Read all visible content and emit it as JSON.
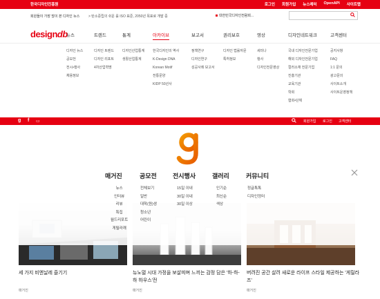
{
  "top_bar": {
    "org": "한국디자인진흥원",
    "links": [
      "로그인",
      "회원가입",
      "뉴스레터",
      "OpenAPI",
      "사이트맵"
    ]
  },
  "notice": {
    "headline": "회원들이 가장 많이 본 디자인 뉴스",
    "item": "> 탄소중립의 쉬운 룰 ISO 표준, 2050년 목표로 개발 중",
    "right": "대한민국디자인전람회..."
  },
  "nav": {
    "logo_main": "design",
    "logo_suffix": "db",
    "items": [
      "뉴스",
      "트렌드",
      "통계",
      "아카이브",
      "보고서",
      "권리보호",
      "영상",
      "디자인네트워크",
      "고객센터"
    ],
    "active_index": 3
  },
  "dropdown": {
    "col_news": [
      "디자인 뉴스",
      "공모전",
      "전시•행사",
      "채용정보"
    ],
    "col_trend": [
      "디자인 트렌드",
      "디자인 리포트",
      "4차산업혁명"
    ],
    "col_stats": [
      "디자인산업통계",
      "생활산업통계"
    ],
    "col_archive": [
      "한국디자인의 역사",
      "K-Design DNA",
      "Korean Motif",
      "전통문양",
      "KIDP 50년사"
    ],
    "col_report": [
      "정책연구",
      "디자인연구",
      "성공사례 보고서"
    ],
    "col_rights": [
      "디자인 법률자문",
      "특허정보"
    ],
    "col_video": [
      "세미나",
      "행사",
      "디자인전문영상"
    ],
    "col_network": [
      "국내 디자인전문기업",
      "해외 디자인전문기업",
      "컬러소재 전문기업",
      "진흥기관",
      "교육기관",
      "학회",
      "협회•단체"
    ],
    "col_support": [
      "공지사항",
      "FAQ",
      "1:1 문의",
      "광고문의",
      "사이트소개",
      "사이트운영정책"
    ]
  },
  "red_bar": {
    "icons": [
      "g",
      "f",
      "▭"
    ],
    "links": [
      "회원가입",
      "로그인",
      "고객센터"
    ]
  },
  "brand_mark": "g",
  "categories": [
    "매거진",
    "공모전",
    "전시행사",
    "갤러리",
    "커뮤니티"
  ],
  "subcategories": {
    "magazine": [
      "뉴스",
      "인터뷰",
      "리뷰",
      "특집",
      "월드리포트",
      "게릴라깨"
    ],
    "contest": [
      "전체보기",
      "일반",
      "대학(원)생",
      "청소년",
      "어린이"
    ],
    "exhibition": [
      "15일 이내",
      "30일 이내",
      "30일 이상"
    ],
    "gallery": [
      "인기순",
      "최신순",
      "색상"
    ],
    "community": [
      "정글톡톡",
      "디자인정터"
    ]
  },
  "articles": [
    {
      "title": "세 가지 비엔날레 즐기기",
      "tag": "매거진"
    },
    {
      "title": "뉴노멀 시대 가정을 보살피며 느끼는 감정 담은 '하-하-하 하우스'전",
      "tag": "매거진"
    },
    {
      "title": "버려진 공간 살려 새로운 라이프 스타일 제공하는 '게릴라즈'",
      "tag": "매거진"
    }
  ],
  "colors": {
    "brand_red": "#e60012",
    "brand_orange": "#f39800"
  }
}
